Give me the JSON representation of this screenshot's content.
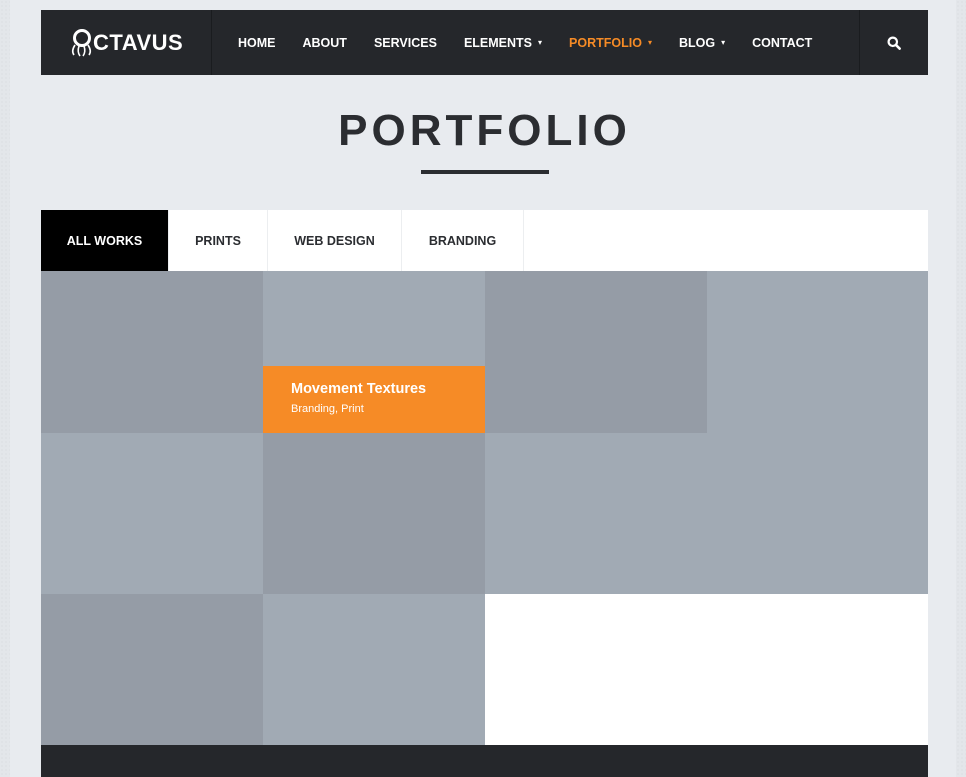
{
  "brand": {
    "logo_text": "CTAVUS"
  },
  "nav": {
    "items": [
      {
        "label": "HOME",
        "dropdown": false,
        "active": false
      },
      {
        "label": "ABOUT",
        "dropdown": false,
        "active": false
      },
      {
        "label": "SERVICES",
        "dropdown": false,
        "active": false
      },
      {
        "label": "ELEMENTS",
        "dropdown": true,
        "active": false
      },
      {
        "label": "PORTFOLIO",
        "dropdown": true,
        "active": true
      },
      {
        "label": "BLOG",
        "dropdown": true,
        "active": false
      },
      {
        "label": "CONTACT",
        "dropdown": false,
        "active": false
      }
    ],
    "search_icon": "search-icon"
  },
  "page": {
    "title": "PORTFOLIO"
  },
  "filters": {
    "items": [
      {
        "label": "ALL WORKS",
        "active": true
      },
      {
        "label": "PRINTS",
        "active": false
      },
      {
        "label": "WEB DESIGN",
        "active": false
      },
      {
        "label": "BRANDING",
        "active": false
      }
    ]
  },
  "portfolio": {
    "hover_item": {
      "title": "Movement Textures",
      "categories": "Branding, Print"
    }
  },
  "colors": {
    "accent": "#f68b26",
    "nav_bg": "#25272b",
    "tile_dark": "#959ca6",
    "tile_light": "#a1aab4",
    "active_tab_bg": "#000000"
  }
}
